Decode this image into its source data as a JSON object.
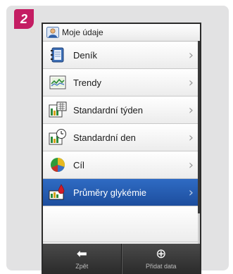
{
  "step": {
    "number": "2"
  },
  "screen": {
    "title": "Moje údaje",
    "title_icon": "user-icon"
  },
  "menu": {
    "items": [
      {
        "label": "Deník",
        "icon": "logbook-icon"
      },
      {
        "label": "Trendy",
        "icon": "trend-graph-icon"
      },
      {
        "label": "Standardní týden",
        "icon": "standard-week-icon"
      },
      {
        "label": "Standardní den",
        "icon": "standard-day-icon"
      },
      {
        "label": "Cíl",
        "icon": "pie-chart-icon"
      },
      {
        "label": "Průměry glykémie",
        "icon": "blood-drop-icon",
        "selected": true
      }
    ],
    "chevron": "›"
  },
  "bottom": {
    "back_label": "Zpět",
    "back_icon": "arrow-left-icon",
    "add_label": "Přidat data",
    "add_icon": "plus-circle-icon"
  },
  "colors": {
    "badge": "#c41d63",
    "selected": "#2f6bc4"
  }
}
